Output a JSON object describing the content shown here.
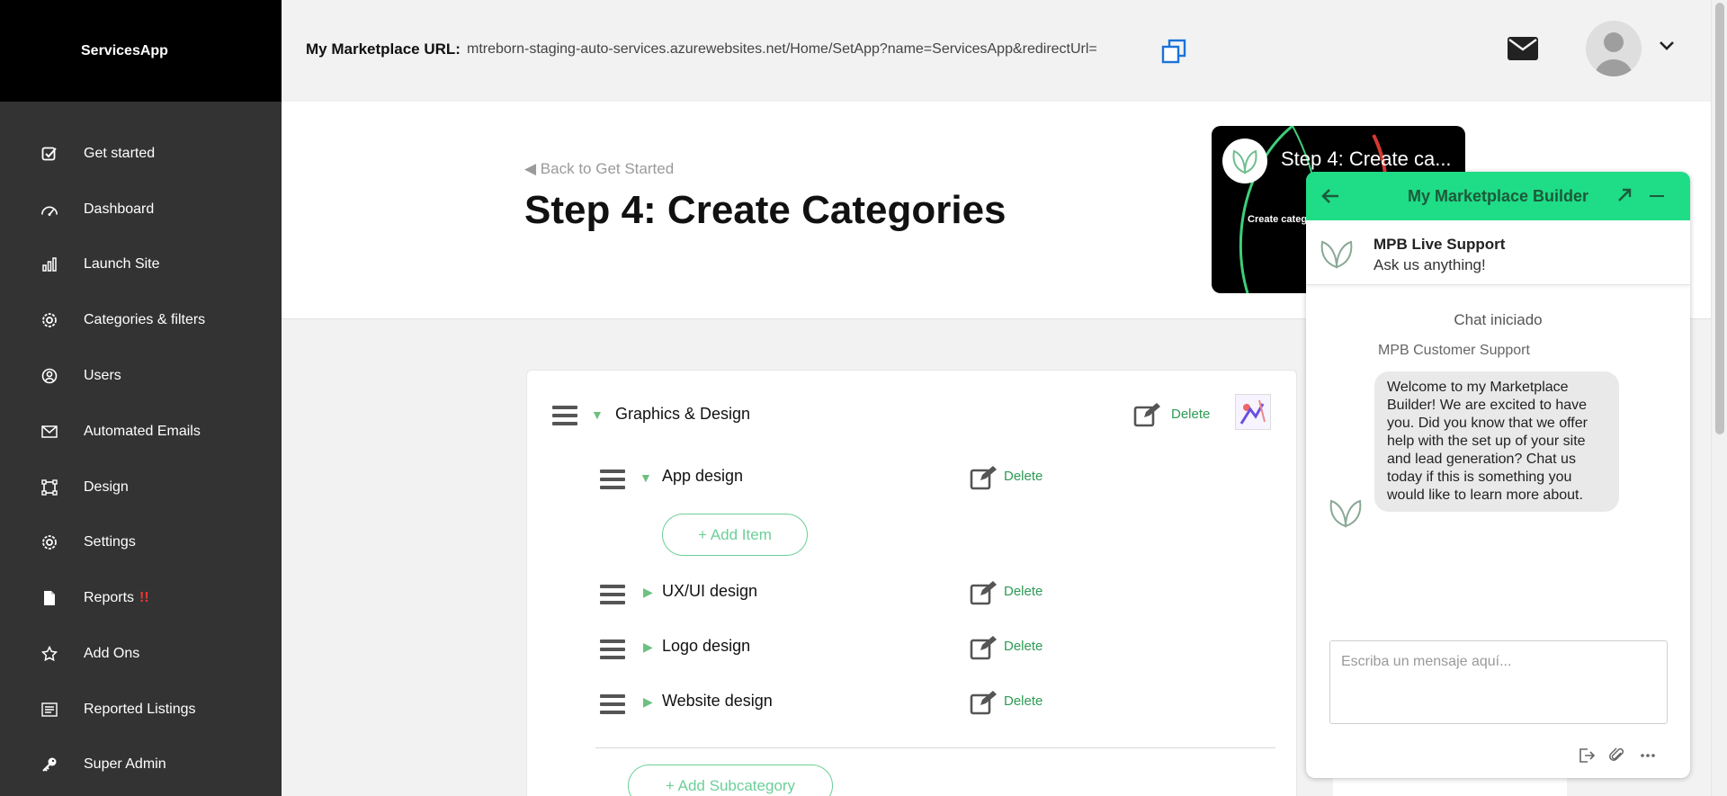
{
  "app": {
    "brand": "ServicesApp"
  },
  "sidebar": {
    "items": [
      {
        "label": "Get started",
        "icon": "checkbox-icon"
      },
      {
        "label": "Dashboard",
        "icon": "gauge-icon"
      },
      {
        "label": "Launch Site",
        "icon": "bar-chart-icon"
      },
      {
        "label": "Categories & filters",
        "icon": "gear-icon"
      },
      {
        "label": "Users",
        "icon": "user-circle-icon"
      },
      {
        "label": "Automated Emails",
        "icon": "envelope-icon"
      },
      {
        "label": "Design",
        "icon": "frame-icon"
      },
      {
        "label": "Settings",
        "icon": "gear-icon"
      },
      {
        "label": "Reports",
        "icon": "file-icon",
        "badge": "!!"
      },
      {
        "label": "Add Ons",
        "icon": "star-icon"
      },
      {
        "label": "Reported Listings",
        "icon": "list-icon"
      },
      {
        "label": "Super Admin",
        "icon": "key-icon"
      }
    ]
  },
  "header": {
    "url_label": "My Marketplace URL:",
    "url_value": "mtreborn-staging-auto-services.azurewebsites.net/Home/SetApp?name=ServicesApp&redirectUrl="
  },
  "page": {
    "back_link": "◀ Back to Get Started",
    "title_bold": "Step 4:",
    "title_rest": " Create Categories",
    "video_title": "Step 4: Create ca...",
    "video_sub": "Create categ"
  },
  "categories": {
    "main": {
      "name": "Graphics & Design",
      "delete": "Delete"
    },
    "subs": [
      {
        "name": "App design",
        "delete": "Delete",
        "expanded": true
      },
      {
        "name": "UX/UI design",
        "delete": "Delete",
        "expanded": false
      },
      {
        "name": "Logo design",
        "delete": "Delete",
        "expanded": false
      },
      {
        "name": "Website design",
        "delete": "Delete",
        "expanded": false
      }
    ],
    "add_item": "+ Add Item",
    "add_subcategory": "+ Add Subcategory"
  },
  "chat": {
    "title": "My Marketplace Builder",
    "agent_name": "MPB Live Support",
    "agent_sub": "Ask us anything!",
    "status": "Chat iniciado",
    "sender": "MPB Customer Support",
    "message": "Welcome to my Marketplace Builder! We are excited to have you. Did you know that we offer help with the set up of your site and lead generation? Chat us today if this is something you would like to learn more about.",
    "input_placeholder": "Escriba un mensaje aquí..."
  },
  "colors": {
    "sidebar_bg": "#333333",
    "brand_bg": "#000000",
    "accent_green": "#1fdc87",
    "delete_green": "#2e9b55",
    "copy_blue": "#1a73d9",
    "alert_red": "#e53935"
  }
}
